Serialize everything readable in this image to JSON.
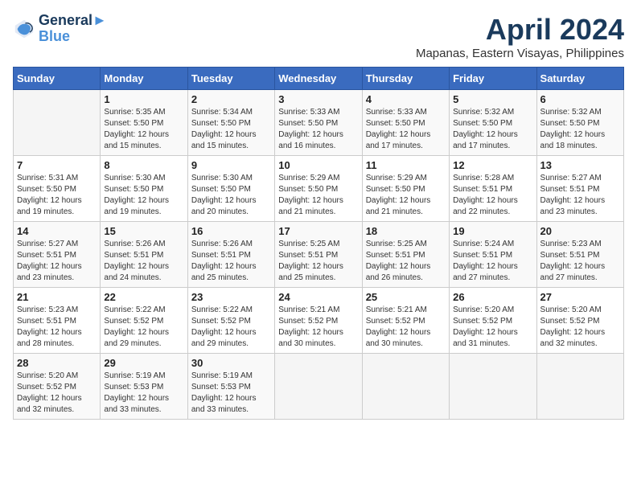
{
  "header": {
    "logo_line1": "General",
    "logo_line2": "Blue",
    "month": "April 2024",
    "location": "Mapanas, Eastern Visayas, Philippines"
  },
  "weekdays": [
    "Sunday",
    "Monday",
    "Tuesday",
    "Wednesday",
    "Thursday",
    "Friday",
    "Saturday"
  ],
  "weeks": [
    [
      {
        "day": "",
        "info": ""
      },
      {
        "day": "1",
        "info": "Sunrise: 5:35 AM\nSunset: 5:50 PM\nDaylight: 12 hours\nand 15 minutes."
      },
      {
        "day": "2",
        "info": "Sunrise: 5:34 AM\nSunset: 5:50 PM\nDaylight: 12 hours\nand 15 minutes."
      },
      {
        "day": "3",
        "info": "Sunrise: 5:33 AM\nSunset: 5:50 PM\nDaylight: 12 hours\nand 16 minutes."
      },
      {
        "day": "4",
        "info": "Sunrise: 5:33 AM\nSunset: 5:50 PM\nDaylight: 12 hours\nand 17 minutes."
      },
      {
        "day": "5",
        "info": "Sunrise: 5:32 AM\nSunset: 5:50 PM\nDaylight: 12 hours\nand 17 minutes."
      },
      {
        "day": "6",
        "info": "Sunrise: 5:32 AM\nSunset: 5:50 PM\nDaylight: 12 hours\nand 18 minutes."
      }
    ],
    [
      {
        "day": "7",
        "info": "Sunrise: 5:31 AM\nSunset: 5:50 PM\nDaylight: 12 hours\nand 19 minutes."
      },
      {
        "day": "8",
        "info": "Sunrise: 5:30 AM\nSunset: 5:50 PM\nDaylight: 12 hours\nand 19 minutes."
      },
      {
        "day": "9",
        "info": "Sunrise: 5:30 AM\nSunset: 5:50 PM\nDaylight: 12 hours\nand 20 minutes."
      },
      {
        "day": "10",
        "info": "Sunrise: 5:29 AM\nSunset: 5:50 PM\nDaylight: 12 hours\nand 21 minutes."
      },
      {
        "day": "11",
        "info": "Sunrise: 5:29 AM\nSunset: 5:50 PM\nDaylight: 12 hours\nand 21 minutes."
      },
      {
        "day": "12",
        "info": "Sunrise: 5:28 AM\nSunset: 5:51 PM\nDaylight: 12 hours\nand 22 minutes."
      },
      {
        "day": "13",
        "info": "Sunrise: 5:27 AM\nSunset: 5:51 PM\nDaylight: 12 hours\nand 23 minutes."
      }
    ],
    [
      {
        "day": "14",
        "info": "Sunrise: 5:27 AM\nSunset: 5:51 PM\nDaylight: 12 hours\nand 23 minutes."
      },
      {
        "day": "15",
        "info": "Sunrise: 5:26 AM\nSunset: 5:51 PM\nDaylight: 12 hours\nand 24 minutes."
      },
      {
        "day": "16",
        "info": "Sunrise: 5:26 AM\nSunset: 5:51 PM\nDaylight: 12 hours\nand 25 minutes."
      },
      {
        "day": "17",
        "info": "Sunrise: 5:25 AM\nSunset: 5:51 PM\nDaylight: 12 hours\nand 25 minutes."
      },
      {
        "day": "18",
        "info": "Sunrise: 5:25 AM\nSunset: 5:51 PM\nDaylight: 12 hours\nand 26 minutes."
      },
      {
        "day": "19",
        "info": "Sunrise: 5:24 AM\nSunset: 5:51 PM\nDaylight: 12 hours\nand 27 minutes."
      },
      {
        "day": "20",
        "info": "Sunrise: 5:23 AM\nSunset: 5:51 PM\nDaylight: 12 hours\nand 27 minutes."
      }
    ],
    [
      {
        "day": "21",
        "info": "Sunrise: 5:23 AM\nSunset: 5:51 PM\nDaylight: 12 hours\nand 28 minutes."
      },
      {
        "day": "22",
        "info": "Sunrise: 5:22 AM\nSunset: 5:52 PM\nDaylight: 12 hours\nand 29 minutes."
      },
      {
        "day": "23",
        "info": "Sunrise: 5:22 AM\nSunset: 5:52 PM\nDaylight: 12 hours\nand 29 minutes."
      },
      {
        "day": "24",
        "info": "Sunrise: 5:21 AM\nSunset: 5:52 PM\nDaylight: 12 hours\nand 30 minutes."
      },
      {
        "day": "25",
        "info": "Sunrise: 5:21 AM\nSunset: 5:52 PM\nDaylight: 12 hours\nand 30 minutes."
      },
      {
        "day": "26",
        "info": "Sunrise: 5:20 AM\nSunset: 5:52 PM\nDaylight: 12 hours\nand 31 minutes."
      },
      {
        "day": "27",
        "info": "Sunrise: 5:20 AM\nSunset: 5:52 PM\nDaylight: 12 hours\nand 32 minutes."
      }
    ],
    [
      {
        "day": "28",
        "info": "Sunrise: 5:20 AM\nSunset: 5:52 PM\nDaylight: 12 hours\nand 32 minutes."
      },
      {
        "day": "29",
        "info": "Sunrise: 5:19 AM\nSunset: 5:53 PM\nDaylight: 12 hours\nand 33 minutes."
      },
      {
        "day": "30",
        "info": "Sunrise: 5:19 AM\nSunset: 5:53 PM\nDaylight: 12 hours\nand 33 minutes."
      },
      {
        "day": "",
        "info": ""
      },
      {
        "day": "",
        "info": ""
      },
      {
        "day": "",
        "info": ""
      },
      {
        "day": "",
        "info": ""
      }
    ]
  ]
}
